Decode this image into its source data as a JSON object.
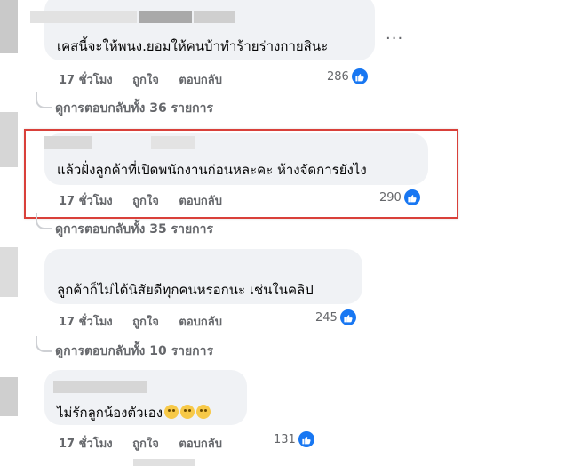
{
  "comments": [
    {
      "text": "เคสนี้จะให้พนง.ยอมให้คนบ้าทำร้ายร่างกายสินะ",
      "time": "17 ชั่วโมง",
      "like_action": "ถูกใจ",
      "reply_action": "ตอบกลับ",
      "reaction_count": "286",
      "replies_link": "ดูการตอบกลับทั้ง 36 รายการ"
    },
    {
      "text": "แล้วฝั่งลูกค้าที่เปิดพนักงานก่อนหละคะ ห้างจัดการยังไง",
      "time": "17 ชั่วโมง",
      "like_action": "ถูกใจ",
      "reply_action": "ตอบกลับ",
      "reaction_count": "290",
      "replies_link": "ดูการตอบกลับทั้ง 35 รายการ",
      "highlighted": true,
      "highlight_color": "#d9403a"
    },
    {
      "text": "ลูกค้าก็ไม่ได้นิสัยดีทุกคนหรอกนะ เช่นในคลิป",
      "time": "17 ชั่วโมง",
      "like_action": "ถูกใจ",
      "reply_action": "ตอบกลับ",
      "reaction_count": "245",
      "replies_link": "ดูการตอบกลับทั้ง 10 รายการ"
    },
    {
      "text": "ไม่รักลูกน้องตัวเอง",
      "time": "17 ชั่วโมง",
      "like_action": "ถูกใจ",
      "reply_action": "ตอบกลับ",
      "reaction_count": "131"
    }
  ],
  "more_options": "...",
  "colors": {
    "like_blue": "#1877f2",
    "bubble_bg": "#f0f2f5",
    "meta_gray": "#65676b"
  },
  "icons": {
    "reaction": "thumbs-up-icon",
    "emoji": "smiling-emoji-icon"
  }
}
